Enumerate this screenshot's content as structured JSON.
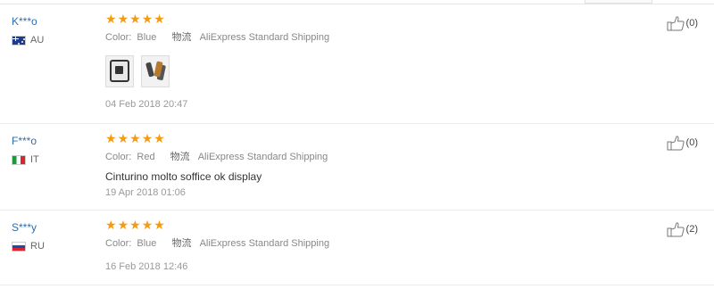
{
  "reviews": [
    {
      "user": "K***o",
      "country_code": "AU",
      "stars": 5,
      "attr_label": "Color:",
      "attr_value": "Blue",
      "shipping_label": "物流",
      "shipping_value": "AliExpress Standard Shipping",
      "comment": "",
      "photos": 2,
      "date": "04 Feb 2018 20:47",
      "helpful_count": "(0)"
    },
    {
      "user": "F***o",
      "country_code": "IT",
      "stars": 5,
      "attr_label": "Color:",
      "attr_value": "Red",
      "shipping_label": "物流",
      "shipping_value": "AliExpress Standard Shipping",
      "comment": "Cinturino molto soffice ok display",
      "photos": 0,
      "date": "19 Apr 2018 01:06",
      "helpful_count": "(0)"
    },
    {
      "user": "S***y",
      "country_code": "RU",
      "stars": 5,
      "attr_label": "Color:",
      "attr_value": "Blue",
      "shipping_label": "物流",
      "shipping_value": "AliExpress Standard Shipping",
      "comment": "",
      "photos": 0,
      "date": "16 Feb 2018 12:46",
      "helpful_count": "(2)"
    }
  ],
  "colors": {
    "star": "#f39c12",
    "username": "#2e6dad"
  },
  "icons": {
    "star": "star-icon",
    "helpful": "thumbs-up-icon"
  }
}
